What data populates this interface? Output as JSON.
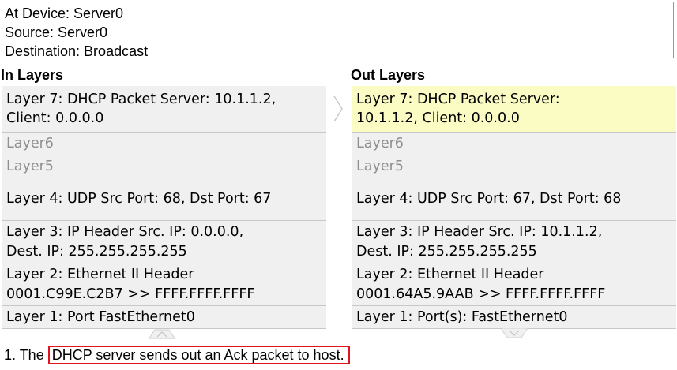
{
  "header": {
    "at_device": "At Device: Server0",
    "source": "Source: Server0",
    "destination": "Destination: Broadcast"
  },
  "in_layers": {
    "title": "In Layers",
    "layers": [
      "Layer 7: DHCP Packet Server: 10.1.1.2,\nClient: 0.0.0.0",
      "Layer6",
      "Layer5",
      "Layer 4: UDP Src Port: 68, Dst Port: 67",
      "Layer 3: IP Header Src. IP: 0.0.0.0,\nDest. IP: 255.255.255.255",
      "Layer 2: Ethernet II Header\n0001.C99E.C2B7 >> FFFF.FFFF.FFFF",
      "Layer 1: Port FastEthernet0"
    ]
  },
  "out_layers": {
    "title": "Out Layers",
    "layers": [
      "Layer 7: DHCP Packet Server:\n10.1.1.2, Client: 0.0.0.0",
      "Layer6",
      "Layer5",
      "Layer 4: UDP Src Port: 67, Dst Port: 68",
      "Layer 3: IP Header Src. IP: 10.1.1.2,\nDest. IP: 255.255.255.255",
      "Layer 2: Ethernet II Header\n0001.64A5.9AAB >> FFFF.FFFF.FFFF",
      "Layer 1: Port(s): FastEthernet0"
    ]
  },
  "description": {
    "number": "1. The ",
    "text": "DHCP server sends out an Ack packet to host."
  },
  "colors": {
    "info_border": "#4fb3c0",
    "layer_bg": "#f0f0f0",
    "active_layer_bg": "#fbfbc4",
    "highlight_border": "#e0141e"
  }
}
